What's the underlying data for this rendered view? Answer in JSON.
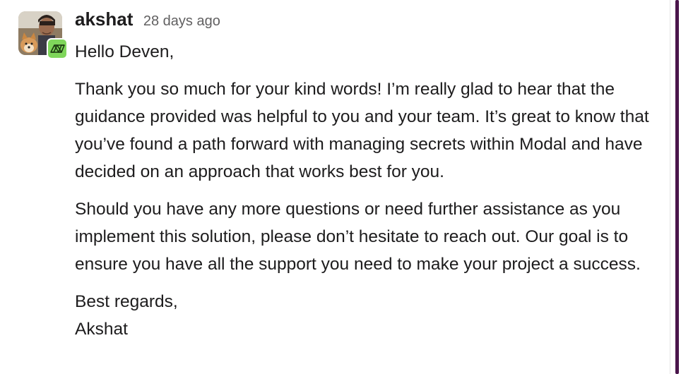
{
  "message": {
    "author": "akshat",
    "timestamp": "28 days ago",
    "avatar_icon": "user-avatar-photo",
    "app_badge_icon": "modal-logo-icon",
    "app_badge_color": "#7fd65b",
    "paragraphs": [
      "Hello Deven,",
      "Thank you so much for your kind words! I’m really glad to hear that the guidance provided was helpful to you and your team. It’s great to know that you’ve found a path forward with managing secrets within Modal and have decided on an approach that works best for you.",
      "Should you have any more questions or need further assistance as you implement this solution, please don’t hesitate to reach out. Our goal is to ensure you have all the support you need to make your project a success."
    ],
    "closing_line_1": "Best regards,",
    "closing_line_2": "Akshat"
  },
  "scrollbar_color": "#4a154b"
}
